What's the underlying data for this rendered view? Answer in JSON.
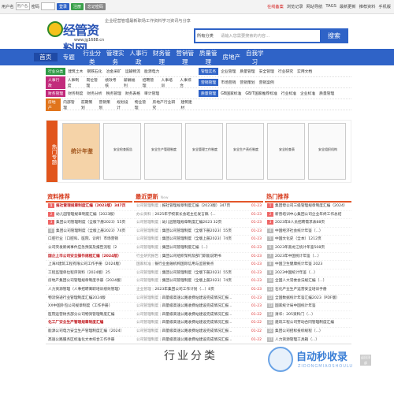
{
  "topbar": {
    "user_ph": "用户名",
    "user_label": "用户名/邮箱",
    "pwd_label": "密码",
    "login": "登录",
    "register": "注册",
    "forgot": "忘记密码",
    "links": [
      "在线备案",
      "浏览记录",
      "网站导航",
      "TAGS",
      "最新更新",
      "推荐资料",
      "手机版"
    ]
  },
  "header": {
    "logo": "经管资料网",
    "url": "www.jg1688.cn",
    "slogan": "企业经营管理最新职场工作资料学习资讯与分享",
    "search_cat": "所有分类",
    "search_ph": "请输入您需要搜索的内容...",
    "search_btn": "搜索"
  },
  "nav": [
    "首页",
    "专题",
    "行业分类",
    "管理实务",
    "人事行政",
    "财务管理",
    "营销管理",
    "质量管理",
    "房地产",
    "自我学习"
  ],
  "cats": [
    {
      "tag": "行业分类",
      "color": "#2e9a45",
      "items": [
        "建筑土木",
        "钢铁石化",
        "冶金采矿",
        "运输物流",
        "能源电力"
      ],
      "tag2": "管理实务",
      "color2": "#2f63c7",
      "items2": [
        "企业管理",
        "质量管理",
        "安全管理",
        "行业研究",
        "实用文档"
      ]
    },
    {
      "tag": "人事行政",
      "color": "#c22b7c",
      "items": [
        "人事制度",
        "岗位管理",
        "绩效考核",
        "薪酬福利",
        "招聘管理",
        "人事培训",
        "人事综合"
      ],
      "tag2": "营销管理",
      "color2": "#2f63c7",
      "items2": [
        "市场营销",
        "营销策划",
        "营销案例"
      ]
    },
    {
      "tag": "财务管理",
      "color": "#c22b7c",
      "items": [
        "财务制度",
        "财务分析",
        "税务管理",
        "财务表格",
        "审计管理"
      ],
      "tag2": "质量管理",
      "color2": "#2f63c7",
      "items2": [
        "GB国家标准",
        "GB/T国家推荐标准",
        "行业标准",
        "企业标准",
        "质量管理"
      ]
    },
    {
      "tag": "房地产",
      "color": "#e1751c",
      "items": [
        "内部管理",
        "前期策划",
        "营销策划",
        "规划设计",
        "物业管理",
        "房地产行业研究",
        "建筑建材"
      ],
      "tag2": "",
      "color2": "",
      "items2": []
    }
  ],
  "topics": {
    "label": "热门专题",
    "items": [
      "统计年鉴",
      "安全检查报告",
      "安全生产管理制度",
      "安全管理工作制度",
      "安全生产责任制度",
      "安全检查表",
      "安全组织机构"
    ]
  },
  "col1": {
    "title": "资料推荐",
    "items": [
      {
        "t": "报社管理规章制度汇编（2023版）347页",
        "b": true,
        "n": "1"
      },
      {
        "t": "幼儿园管理规章制度汇编（2023版）",
        "n": "2"
      },
      {
        "t": "集团公司管理制度（全版下册2023）55页",
        "n": "3"
      },
      {
        "t": "集团公司管理制度（全版上册2023）74页",
        "n": "4"
      },
      {
        "t": "口腔行业（口腔科、医院、诊所）市场营销"
      },
      {
        "t": "公司突发新闻事件应急预案及报告流程（2"
      },
      {
        "t": "国企上市公司安全操作规程汇编（2024版）",
        "b": true
      },
      {
        "t": "上海X建筑工程有限公司工作手册（2024版）"
      },
      {
        "t": "工程监理单位程序资料（2024版）25"
      },
      {
        "t": "房地产集团公司管理规章制度手册（2024版）"
      },
      {
        "t": "人力资源管理（人事招聘离职培训绩效管理）"
      },
      {
        "t": "物流快递行业管理制度汇编2024版"
      },
      {
        "t": "XX中国外包公司规章制度（工作手册）"
      },
      {
        "t": "医院运营财务部分公司物资管理制度汇编"
      },
      {
        "t": "化工厂安全生产管理规章制度汇编",
        "b": true
      },
      {
        "t": "能源公司电力安全生产管理制度汇编（2024）"
      },
      {
        "t": "高速公路服务区标准化文本综合工作手册"
      },
      {
        "t": "高速公路服务区标准化文本运营工作手册"
      },
      {
        "t": "高速公路服务区标准化文本收费工作手册"
      }
    ]
  },
  "col2": {
    "title": "最近更新",
    "sub": "New",
    "items": [
      {
        "c": "公司管理制度",
        "t": "报社管理规章制度汇编（2023版）347页",
        "d": "01-23"
      },
      {
        "c": "办公资料",
        "t": "2025年学校家长会班主任发言稿（...",
        "d": "01-23"
      },
      {
        "c": "公司管理制度",
        "t": "幼儿园管理规章制度汇编2023 32页",
        "d": "01-23"
      },
      {
        "c": "公司管理制度",
        "t": "集团公司管理制度（全版下册2023）55页",
        "d": "01-23"
      },
      {
        "c": "公司管理制度",
        "t": "集团公司管理制度（全版上册2023）74页",
        "d": "01-23"
      },
      {
        "c": "公司管理制度",
        "t": "集团公司管理制度汇编（...）",
        "d": "01-23"
      },
      {
        "c": "行业研究报告",
        "t": "集团公司组织架构及部门职能说明书",
        "d": "01-23"
      },
      {
        "c": "国家标准",
        "t": "银行业金融机构国际信用与监管要点",
        "d": "01-23"
      },
      {
        "c": "公司管理制度",
        "t": "集团公司管理制度（全版下册2023）55页",
        "d": "01-23"
      },
      {
        "c": "公司管理制度",
        "t": "集团公司管理制度（全版上册2023）74页",
        "d": "01-23"
      },
      {
        "c": "企业管理",
        "t": "2023年集团公司工作计划（...）8页",
        "d": "01-23"
      },
      {
        "c": "公司管理制度",
        "t": "四量级高速公路收费站建设完成情况汇报...",
        "d": "01-23"
      },
      {
        "c": "公司管理制度",
        "t": "四量级高速公路收费站建设完成情况汇报...",
        "d": "01-23"
      },
      {
        "c": "公司管理制度",
        "t": "四量级高速公路收费站建设完成情况汇报...",
        "d": "01-22"
      },
      {
        "c": "公司管理制度",
        "t": "四量级高速公路收费站建设完成情况汇报...",
        "d": "01-22"
      },
      {
        "c": "公司管理制度",
        "t": "四量级高速公路收费站建设完成情况汇报...",
        "d": "01-22"
      },
      {
        "c": "公司管理制度",
        "t": "四量级高速公路收费站建设完成情况汇报...",
        "d": "01-22"
      },
      {
        "c": "公司管理制度",
        "t": "四量级高速公路收费站建设完成情况汇报...",
        "d": "01-22"
      },
      {
        "c": "公司管理制度",
        "t": "四量级高速公路收费站建设完成情况汇报...",
        "d": "01-22"
      }
    ]
  },
  "col3": {
    "title": "热门推荐",
    "items": [
      "集团母公司三级管理规章制度汇编（2024）",
      "新晋培训中心集团公司企业年终工作总结",
      "2023年8人员招聘需求表88页",
      "中国经济社会统计年鉴（...）",
      "中国文化史（全本）1212页",
      "2023年黑龙江统计年鉴508页",
      "2023年中国统计年鉴（...）",
      "中国卫生健康统计年鉴 2023",
      "2023中国统计年鉴（...）",
      "全国人大常委会法规汇编（...）",
      "石化产业生产运营安全培训手册",
      "全国数据统计年鉴汇编2023（PDF版）",
      "国家统计局中国统计年鉴",
      "清华：205资料门（...）",
      "建筑工程公司劳动合同管理制度汇编",
      "集团公司招标投标规程（...）",
      "人力资源管理工具箱（...）",
      "集团公司管理工具箱（...）",
      "2023年中国统计年鉴"
    ]
  },
  "footer": {
    "title": "行业分类"
  },
  "watermark": {
    "text": "自动秒收录",
    "sub": "ZIDONGMIAOSHOULU"
  },
  "totop": "返回顶部"
}
